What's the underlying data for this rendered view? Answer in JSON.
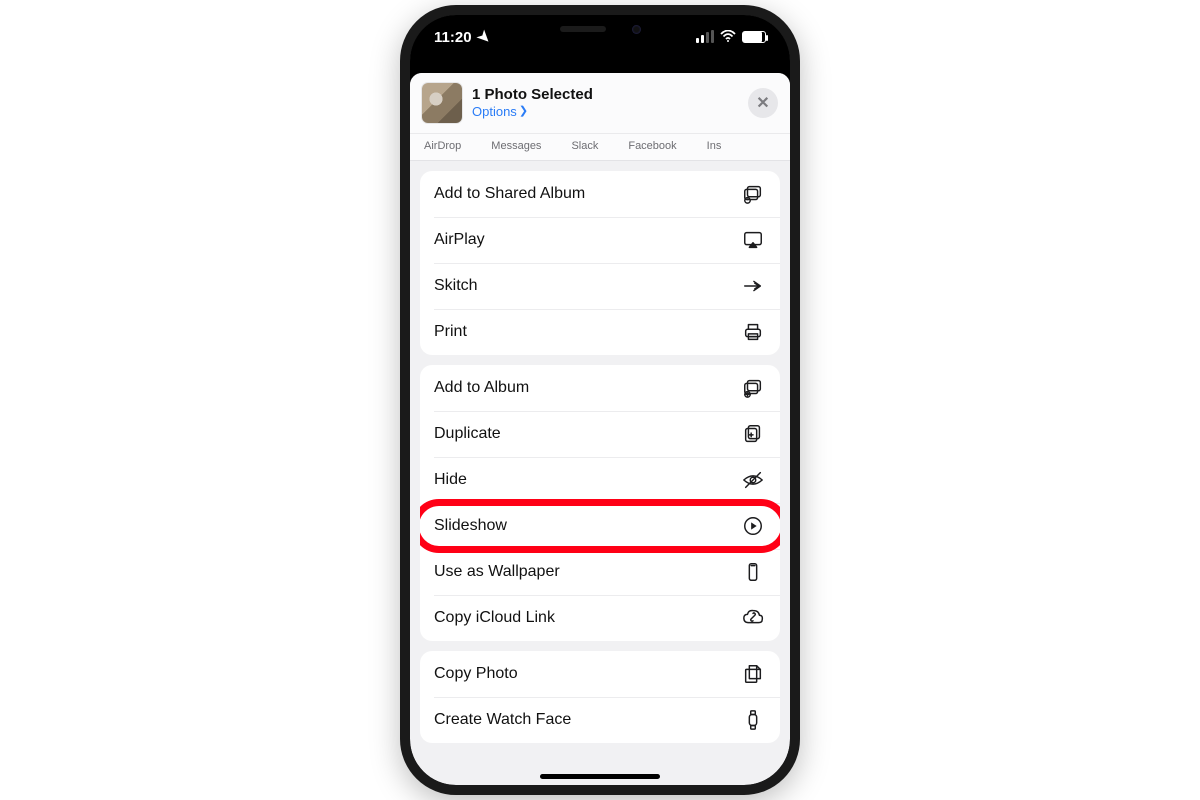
{
  "statusbar": {
    "time": "11:20"
  },
  "sheet": {
    "header": {
      "title": "1 Photo Selected",
      "options_label": "Options"
    },
    "share_targets": [
      "AirDrop",
      "Messages",
      "Slack",
      "Facebook",
      "Ins"
    ],
    "groups": [
      {
        "rows": [
          {
            "label": "Add to Shared Album",
            "icon": "shared-album"
          },
          {
            "label": "AirPlay",
            "icon": "airplay"
          },
          {
            "label": "Skitch",
            "icon": "skitch"
          },
          {
            "label": "Print",
            "icon": "print"
          }
        ]
      },
      {
        "rows": [
          {
            "label": "Add to Album",
            "icon": "add-album"
          },
          {
            "label": "Duplicate",
            "icon": "duplicate"
          },
          {
            "label": "Hide",
            "icon": "hide"
          },
          {
            "label": "Slideshow",
            "icon": "slideshow",
            "highlighted": true
          },
          {
            "label": "Use as Wallpaper",
            "icon": "wallpaper"
          },
          {
            "label": "Copy iCloud Link",
            "icon": "icloud-link"
          }
        ]
      },
      {
        "rows": [
          {
            "label": "Copy Photo",
            "icon": "copy-photo"
          },
          {
            "label": "Create Watch Face",
            "icon": "watch-face"
          }
        ]
      }
    ]
  },
  "annotation": {
    "highlight_color": "#ff0016"
  }
}
